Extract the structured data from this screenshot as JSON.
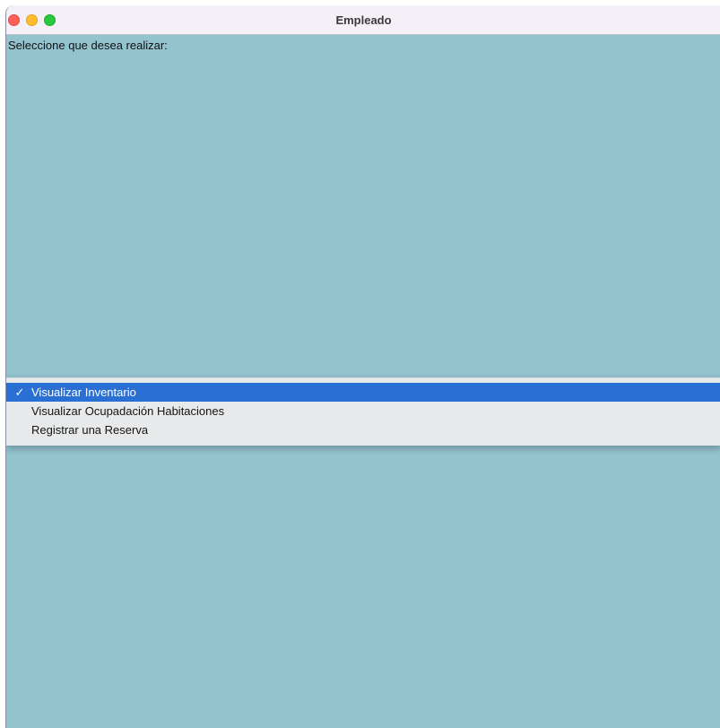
{
  "window": {
    "title": "Empleado",
    "prompt": "Seleccione que desea realizar:"
  },
  "menu": {
    "options": [
      {
        "label": "Visualizar Inventario",
        "selected": true,
        "check": "✓"
      },
      {
        "label": "Visualizar Ocupadación Habitaciones",
        "selected": false,
        "check": ""
      },
      {
        "label": "Registrar una Reserva",
        "selected": false,
        "check": ""
      }
    ]
  },
  "colors": {
    "window_background": "#92c3cf",
    "selection": "#2a70d4",
    "menu_background": "#e7e9ea",
    "titlebar": "#f5eff7"
  },
  "icons": {
    "close": "close-icon",
    "minimize": "minimize-icon",
    "zoom": "zoom-icon",
    "check": "check-icon"
  }
}
